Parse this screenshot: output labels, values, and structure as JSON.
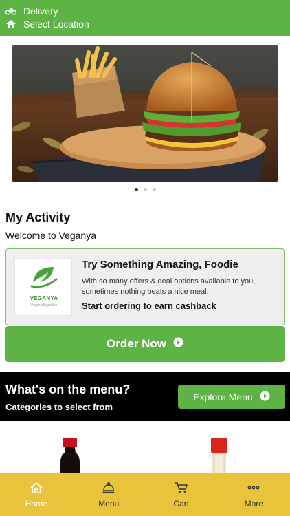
{
  "header": {
    "delivery_label": "Delivery",
    "location_label": "Select Location"
  },
  "banner": {
    "slides": 3,
    "active_slide": 1
  },
  "activity": {
    "title": "My Activity",
    "welcome": "Welcome to Veganya"
  },
  "promo": {
    "logo_text": "VEGANYA",
    "logo_tagline": "Vegan all you like",
    "title": "Try Something Amazing, Foodie",
    "body": "With so many offers & deal options available to you, sometimes nothing beats a nice meal.",
    "cta": "Start ordering to earn cashback"
  },
  "order_button": {
    "label": "Order Now"
  },
  "menu_section": {
    "title": "What's on the menu?",
    "subtitle": "Categories to select from",
    "explore_label": "Explore Menu"
  },
  "bottom_nav": {
    "items": [
      {
        "label": "Home",
        "icon": "home-icon",
        "active": true
      },
      {
        "label": "Menu",
        "icon": "cloche-icon",
        "active": false
      },
      {
        "label": "Cart",
        "icon": "cart-icon",
        "active": false
      },
      {
        "label": "More",
        "icon": "more-icon",
        "active": false
      }
    ]
  },
  "colors": {
    "brand_green": "#5db445",
    "nav_yellow": "#e9c33a",
    "band_black": "#000000"
  }
}
